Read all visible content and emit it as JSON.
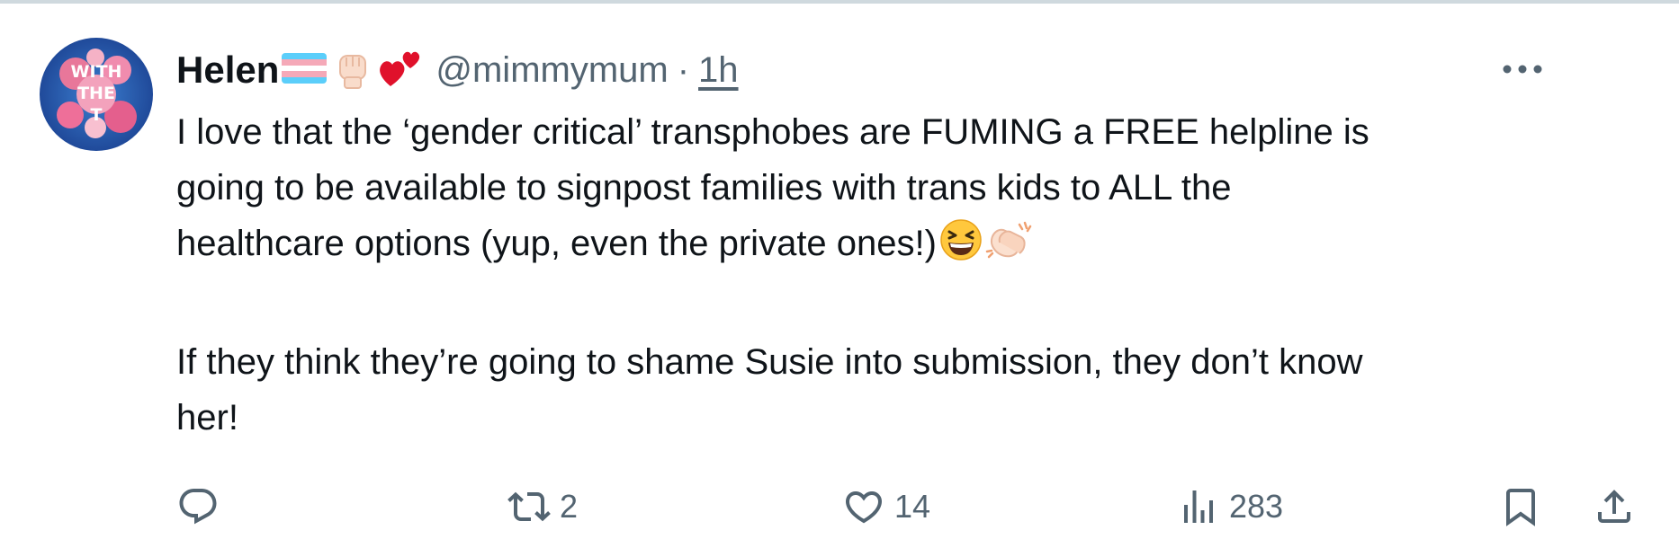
{
  "tweet": {
    "author": {
      "display_name": "Helen",
      "name_emoji_icons": [
        "transgender-flag-icon",
        "raised-fist-icon",
        "two-hearts-icon"
      ],
      "handle": "@mimmymum",
      "separator": "·",
      "time": "1h",
      "avatar_text": [
        "WITH",
        "THE",
        "T"
      ]
    },
    "text": {
      "line1": "I love that the ‘gender critical’ transphobes are FUMING a FREE helpline is",
      "line2": "going to be available to signpost families with trans kids to ALL the",
      "line3": "healthcare options (yup, even the private ones!)",
      "line3_emoji_icons": [
        "grinning-squinting-face-icon",
        "clapping-hands-icon"
      ],
      "line4": "If they think they’re going to shame Susie into submission, they don’t know",
      "line5": "her!"
    },
    "actions": {
      "reply_count": "",
      "retweet_count": "2",
      "like_count": "14",
      "views_count": "283"
    },
    "colors": {
      "text": "#0f1419",
      "secondary": "#536471",
      "border": "#cfd9de",
      "trans_blue": "#5BCEFA",
      "trans_pink": "#F5A9B8"
    }
  }
}
